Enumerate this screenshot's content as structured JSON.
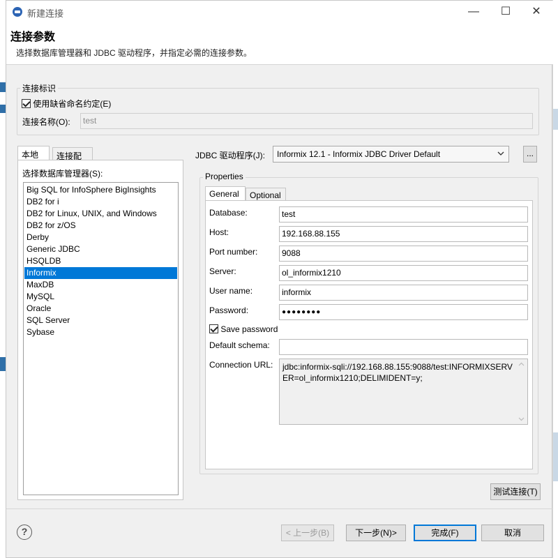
{
  "window": {
    "title": "新建连接",
    "minimize": "—",
    "maximize": "☐",
    "close": "✕"
  },
  "header": {
    "title": "连接参数",
    "description": "选择数据库管理器和 JDBC 驱动程序，并指定必需的连接参数。"
  },
  "identity": {
    "legend": "连接标识",
    "use_default_naming": "使用缺省命名约定(E)",
    "use_default_checked": true,
    "name_label": "连接名称(O):",
    "name_value": "test"
  },
  "left_tabs": [
    "本地",
    "连接配置"
  ],
  "db_manager": {
    "label": "选择数据库管理器(S):",
    "items": [
      "Big SQL for InfoSphere BigInsights",
      "DB2 for i",
      "DB2 for Linux, UNIX, and Windows",
      "DB2 for z/OS",
      "Derby",
      "Generic JDBC",
      "HSQLDB",
      "Informix",
      "MaxDB",
      "MySQL",
      "Oracle",
      "SQL Server",
      "Sybase"
    ],
    "selected": "Informix"
  },
  "jdbc": {
    "label": "JDBC 驱动程序(J):",
    "value": "Informix 12.1 - Informix JDBC Driver Default",
    "browse": "..."
  },
  "properties": {
    "legend": "Properties",
    "tabs": [
      "General",
      "Optional"
    ],
    "fields": {
      "database": {
        "label": "Database:",
        "value": "test"
      },
      "host": {
        "label": "Host:",
        "value": "192.168.88.155"
      },
      "port": {
        "label": "Port number:",
        "value": "9088"
      },
      "server": {
        "label": "Server:",
        "value": "ol_informix1210"
      },
      "username": {
        "label": "User name:",
        "value": "informix"
      },
      "password": {
        "label": "Password:",
        "value": "●●●●●●●●"
      }
    },
    "save_password": "Save password",
    "save_password_checked": true,
    "schema": {
      "label": "Default schema:",
      "value": ""
    },
    "url": {
      "label": "Connection URL:",
      "value": "jdbc:informix-sqli://192.168.88.155:9088/test:INFORMIXSERVER=ol_informix1210;DELIMIDENT=y;"
    }
  },
  "buttons": {
    "test": "测试连接(T)",
    "back": "< 上一步(B)",
    "next": "下一步(N)>",
    "finish": "完成(F)",
    "cancel": "取消"
  },
  "help_icon": "?",
  "colors": {
    "selection": "#0078d7",
    "default_button_border": "#0078d7",
    "title_icon": "#2c64b4"
  }
}
